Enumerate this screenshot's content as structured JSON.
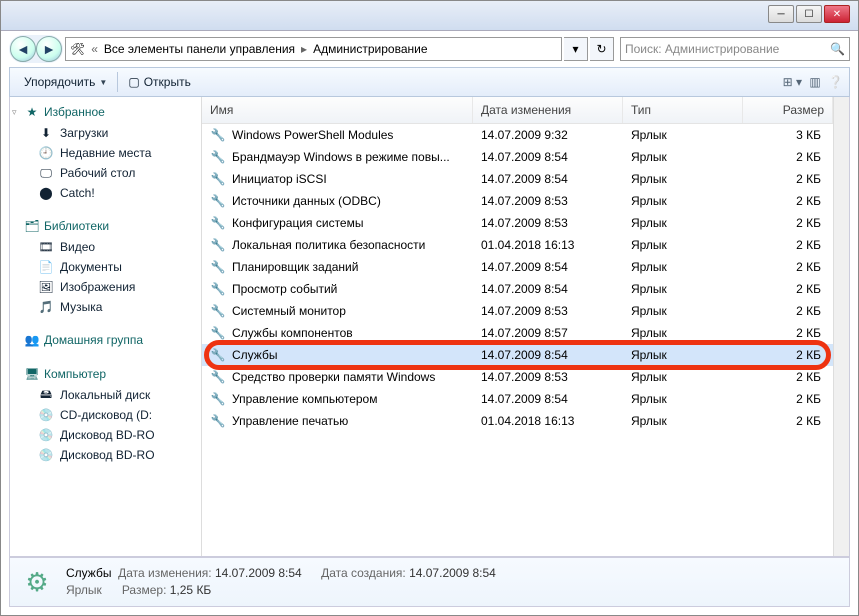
{
  "breadcrumb": {
    "part1": "Все элементы панели управления",
    "part2": "Администрирование"
  },
  "search": {
    "placeholder": "Поиск: Администрирование"
  },
  "toolbar": {
    "organize": "Упорядочить",
    "open": "Открыть"
  },
  "nav": {
    "favorites": {
      "label": "Избранное",
      "items": [
        "Загрузки",
        "Недавние места",
        "Рабочий стол",
        "Catch!"
      ]
    },
    "libraries": {
      "label": "Библиотеки",
      "items": [
        "Видео",
        "Документы",
        "Изображения",
        "Музыка"
      ]
    },
    "homegroup": {
      "label": "Домашняя группа"
    },
    "computer": {
      "label": "Компьютер",
      "items": [
        "Локальный диск",
        "CD-дисковод (D:",
        "Дисковод BD-RO",
        "Дисковод BD-RO"
      ]
    }
  },
  "columns": {
    "name": "Имя",
    "date": "Дата изменения",
    "type": "Тип",
    "size": "Размер"
  },
  "files": [
    {
      "name": "Windows PowerShell Modules",
      "date": "14.07.2009 9:32",
      "type": "Ярлык",
      "size": "3 КБ"
    },
    {
      "name": "Брандмауэр Windows в режиме повы...",
      "date": "14.07.2009 8:54",
      "type": "Ярлык",
      "size": "2 КБ"
    },
    {
      "name": "Инициатор iSCSI",
      "date": "14.07.2009 8:54",
      "type": "Ярлык",
      "size": "2 КБ"
    },
    {
      "name": "Источники данных (ODBC)",
      "date": "14.07.2009 8:53",
      "type": "Ярлык",
      "size": "2 КБ"
    },
    {
      "name": "Конфигурация системы",
      "date": "14.07.2009 8:53",
      "type": "Ярлык",
      "size": "2 КБ"
    },
    {
      "name": "Локальная политика безопасности",
      "date": "01.04.2018 16:13",
      "type": "Ярлык",
      "size": "2 КБ"
    },
    {
      "name": "Планировщик заданий",
      "date": "14.07.2009 8:54",
      "type": "Ярлык",
      "size": "2 КБ"
    },
    {
      "name": "Просмотр событий",
      "date": "14.07.2009 8:54",
      "type": "Ярлык",
      "size": "2 КБ"
    },
    {
      "name": "Системный монитор",
      "date": "14.07.2009 8:53",
      "type": "Ярлык",
      "size": "2 КБ"
    },
    {
      "name": "Службы компонентов",
      "date": "14.07.2009 8:57",
      "type": "Ярлык",
      "size": "2 КБ"
    },
    {
      "name": "Службы",
      "date": "14.07.2009 8:54",
      "type": "Ярлык",
      "size": "2 КБ",
      "selected": true,
      "highlighted": true
    },
    {
      "name": "Средство проверки памяти Windows",
      "date": "14.07.2009 8:53",
      "type": "Ярлык",
      "size": "2 КБ"
    },
    {
      "name": "Управление компьютером",
      "date": "14.07.2009 8:54",
      "type": "Ярлык",
      "size": "2 КБ"
    },
    {
      "name": "Управление печатью",
      "date": "01.04.2018 16:13",
      "type": "Ярлык",
      "size": "2 КБ"
    }
  ],
  "details": {
    "title": "Службы",
    "dateModLabel": "Дата изменения:",
    "dateMod": "14.07.2009 8:54",
    "dateCreatedLabel": "Дата создания:",
    "dateCreated": "14.07.2009 8:54",
    "typeLabel": "Ярлык",
    "sizeLabel": "Размер:",
    "size": "1,25 КБ"
  }
}
